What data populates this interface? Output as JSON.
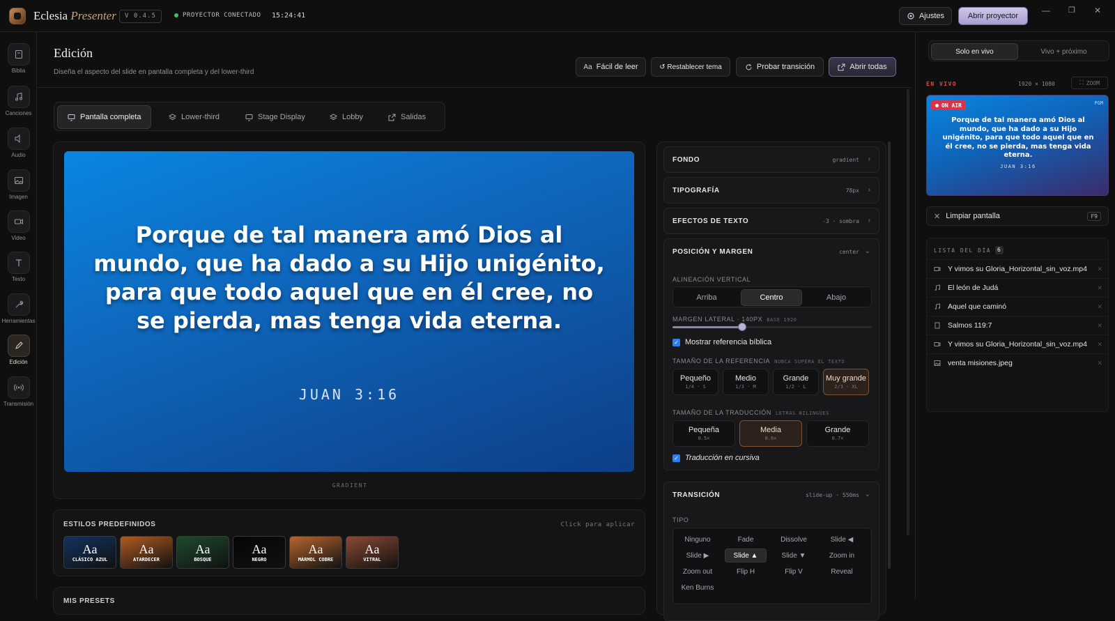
{
  "topbar": {
    "app_name": "Eclesia",
    "app_name_accent": "Presenter",
    "version": "V 0.4.5",
    "status": "PROYECTOR CONECTADO",
    "clock": "15:24:41",
    "settings_label": "Ajustes",
    "open_projector_label": "Abrir proyector",
    "status_color": "#3fbf6a"
  },
  "rail": {
    "items": [
      {
        "label": "Biblia",
        "icon": "book-icon"
      },
      {
        "label": "Canciones",
        "icon": "music-note-icon"
      },
      {
        "label": "Audio",
        "icon": "speaker-icon"
      },
      {
        "label": "Imagen",
        "icon": "image-icon"
      },
      {
        "label": "Video",
        "icon": "video-camera-icon"
      },
      {
        "label": "Texto",
        "icon": "text-icon"
      },
      {
        "label": "Herramientas",
        "icon": "wrench-icon"
      },
      {
        "label": "Edición",
        "icon": "pencil-icon",
        "active": true
      },
      {
        "label": "Transmisión",
        "icon": "broadcast-icon"
      }
    ]
  },
  "header": {
    "title": "Edición",
    "subtitle": "Diseña el aspecto del slide en pantalla completa y del lower-third",
    "buttons": {
      "easy_read": "Fácil de leer",
      "reset_theme": "↺ Restablecer tema",
      "test_transition": "Probar transición",
      "open_all": "Abrir todas"
    }
  },
  "tabs": [
    {
      "label": "Pantalla completa",
      "active": true
    },
    {
      "label": "Lower-third"
    },
    {
      "label": "Stage Display"
    },
    {
      "label": "Lobby"
    },
    {
      "label": "Salidas"
    }
  ],
  "preview": {
    "verse": "Porque de tal manera amó Dios al mundo, que ha dado a su Hijo unigénito, para que todo aquel que en él cree, no se pierda, mas tenga vida eterna.",
    "reference": "JUAN 3:16",
    "caption": "GRADIENT"
  },
  "presets": {
    "title": "ESTILOS PREDEFINIDOS",
    "hint": "Click para aplicar",
    "glyph": "Aa",
    "items": [
      {
        "name": "CLÁSICO AZUL",
        "color": "#12325e"
      },
      {
        "name": "ATARDECER",
        "color": "#b25a22"
      },
      {
        "name": "BOSQUE",
        "color": "#1e4a2c"
      },
      {
        "name": "NEGRO",
        "color": "#050505"
      },
      {
        "name": "MÁRMOL COBRE",
        "color": "#b8652e"
      },
      {
        "name": "VITRAL",
        "color": "#8a4a34"
      }
    ]
  },
  "my_presets": {
    "title": "MIS PRESETS"
  },
  "settings": {
    "fondo": {
      "title": "FONDO",
      "value": "gradient"
    },
    "tipografia": {
      "title": "TIPOGRAFÍA",
      "value": "78px"
    },
    "efectos": {
      "title": "EFECTOS DE TEXTO",
      "value": "-3 · sombra"
    },
    "posicion": {
      "title": "POSICIÓN Y MARGEN",
      "value": "center",
      "vertical_label": "ALINEACIÓN VERTICAL",
      "vertical_options": [
        "Arriba",
        "Centro",
        "Abajo"
      ],
      "vertical_selected": "Centro",
      "margin_label": "MARGEN LATERAL · 140PX",
      "margin_base": "BASE 1920",
      "margin_fraction": 0.35,
      "show_reference_label": "Mostrar referencia bíblica",
      "ref_size_label": "TAMAÑO DE LA REFERENCIA",
      "ref_size_hint": "NUNCA SUPERA EL TEXTO",
      "ref_sizes": [
        {
          "name": "Pequeño",
          "sub": "1/4 · S"
        },
        {
          "name": "Medio",
          "sub": "1/3 · M"
        },
        {
          "name": "Grande",
          "sub": "1/2 · L"
        },
        {
          "name": "Muy grande",
          "sub": "2/3 · XL",
          "selected": true
        }
      ],
      "trans_size_label": "TAMAÑO DE LA TRADUCCIÓN",
      "trans_size_hint": "LETRAS BILINGÜES",
      "trans_sizes": [
        {
          "name": "Pequeña",
          "sub": "0.5×"
        },
        {
          "name": "Media",
          "sub": "0.6×",
          "selected": true
        },
        {
          "name": "Grande",
          "sub": "0.7×"
        }
      ],
      "italic_label": "Traducción en cursiva"
    },
    "transicion": {
      "title": "TRANSICIÓN",
      "value": "slide-up · 550ms",
      "type_label": "TIPO",
      "types": [
        "Ninguno",
        "Fade",
        "Dissolve",
        "Slide ◀",
        "Slide ▶",
        "Slide ▲",
        "Slide ▼",
        "Zoom in",
        "Zoom out",
        "Flip H",
        "Flip V",
        "Reveal",
        "Ken Burns"
      ],
      "selected": "Slide ▲"
    }
  },
  "right": {
    "tabs": [
      "Solo en vivo",
      "Vivo + próximo"
    ],
    "live_label": "EN VIVO",
    "resolution": "1920 × 1080",
    "zoom_label": "ZOOM",
    "on_air": "ON AIR",
    "pgm": "PGM",
    "clear_label": "Limpiar pantalla",
    "clear_key": "F9",
    "playlist_title": "LISTA DEL DÍA",
    "playlist_count": "6",
    "playlist": [
      {
        "label": "Y vimos su Gloria_Horizontal_sin_voz.mp4",
        "icon": "video-icon"
      },
      {
        "label": "El león de Judá",
        "icon": "music-note-icon"
      },
      {
        "label": "Aquel que caminó",
        "icon": "music-note-icon"
      },
      {
        "label": "Salmos 119:7",
        "icon": "book-icon"
      },
      {
        "label": "Y vimos su Gloria_Horizontal_sin_voz.mp4",
        "icon": "video-icon"
      },
      {
        "label": "venta misiones.jpeg",
        "icon": "image-icon"
      }
    ]
  }
}
